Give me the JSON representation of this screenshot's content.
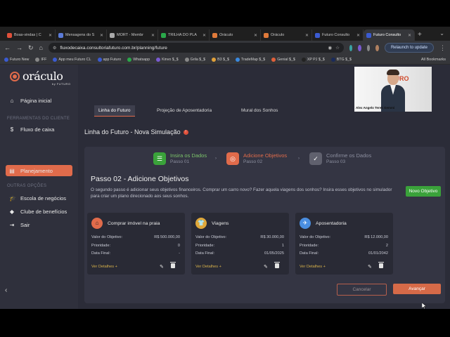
{
  "browser": {
    "tabs": [
      {
        "label": "Boas-vindas | C",
        "color": "#e0503a",
        "active": false
      },
      {
        "label": "Mensagens do S",
        "color": "#5b7bd8",
        "active": false
      },
      {
        "label": "MORT - Membr",
        "color": "#aaaaaa",
        "active": false
      },
      {
        "label": "TRILHA DO PLA",
        "color": "#2aa84a",
        "active": false
      },
      {
        "label": "Oráculo",
        "color": "#e07a3a",
        "active": false
      },
      {
        "label": "Oráculo",
        "color": "#e07a3a",
        "active": false
      },
      {
        "label": "Futuro Consulto",
        "color": "#3b5bd1",
        "active": false
      },
      {
        "label": "Futuro Consulto",
        "color": "#3b5bd1",
        "active": true
      }
    ],
    "url": "fluxodecaixa.consultoriafuturo.com.br/planning/future",
    "relaunch_label": "Relaunch to update",
    "bookmarks": [
      {
        "label": "Futuro New",
        "color": "#3b5bd1"
      },
      {
        "label": "IFF",
        "color": "#888888"
      },
      {
        "label": "App meu Futuro CL",
        "color": "#3b5bd1"
      },
      {
        "label": "app Futuro",
        "color": "#3b5bd1"
      },
      {
        "label": "Whatsapp",
        "color": "#2aa84a"
      },
      {
        "label": "Kinvo $_$",
        "color": "#7a5bd1"
      },
      {
        "label": "Grila $_$",
        "color": "#888888"
      },
      {
        "label": "B3 $_$",
        "color": "#e0a03a"
      },
      {
        "label": "TradeMap $_$",
        "color": "#3a8ae0"
      },
      {
        "label": "Genial $_$",
        "color": "#e0603a"
      },
      {
        "label": "XP PJ $_$",
        "color": "#222222"
      },
      {
        "label": "BTG $_$",
        "color": "#1a2a5a"
      }
    ],
    "all_bookmarks_label": "All Bookmarks"
  },
  "sidebar": {
    "logo_text": "oráculo",
    "logo_sub": "by FUTURO",
    "home_label": "Página inicial",
    "tools_section": "FERRAMENTAS DO CLIENTE",
    "cashflow_label": "Fluxo de caixa",
    "planning_label": "Planejamento",
    "other_section": "OUTRAS OPÇÕES",
    "business_school_label": "Escola de negócios",
    "benefits_club_label": "Clube de benefícios",
    "logout_label": "Sair"
  },
  "topnav": {
    "future_line": "Linha do Futuro",
    "retirement": "Projeção de Aposentadoria",
    "dreams_wall": "Mural dos Sonhos"
  },
  "video": {
    "name": "Alex Angelo Terek Gemmi",
    "brand": "TURO"
  },
  "page": {
    "title": "Linha do Futuro - Nova Simulação"
  },
  "wizard": {
    "steps": [
      {
        "title": "Insira os Dados",
        "sub": "Passo 01",
        "color": "#3aa23a",
        "title_color": "#7cc46a"
      },
      {
        "title": "Adicione Objetivos",
        "sub": "Passo 02",
        "color": "#e06b4b",
        "title_color": "#e06b4b"
      },
      {
        "title": "Confirme os Dados",
        "sub": "Passo 03",
        "color": "#60616e",
        "title_color": "#8c8f9f"
      }
    ],
    "step_title": "Passo 02 - Adicione Objetivos",
    "step_desc": "O segundo passo é adicionar seus objetivos financeiros. Comprar um carro novo? Fazer aquela viagens dos sonhos? Insira esses objetivos no simulador para criar um plano direcionado aos seus sonhos.",
    "new_goal_label": "Novo Objetivo",
    "cancel_label": "Cancelar",
    "next_label": "Avançar"
  },
  "goal_labels": {
    "value": "Valor do Objetivo:",
    "priority": "Prioridade:",
    "date": "Data Final:",
    "details": "Ver Detalhes +"
  },
  "goals": [
    {
      "title": "Comprar imóvel na praia",
      "icon": "house-icon",
      "color": "#e06b4b",
      "value": "R$ 500.000,00",
      "priority": "0",
      "date": "-"
    },
    {
      "title": "Viagens",
      "icon": "tshirt-icon",
      "color": "#e0a83a",
      "value": "R$ 30.000,00",
      "priority": "1",
      "date": "01/05/2025"
    },
    {
      "title": "Aposentadoria",
      "icon": "airplane-icon",
      "color": "#4a8ee0",
      "value": "R$ 12.000,00",
      "priority": "2",
      "date": "01/01/2042"
    }
  ]
}
